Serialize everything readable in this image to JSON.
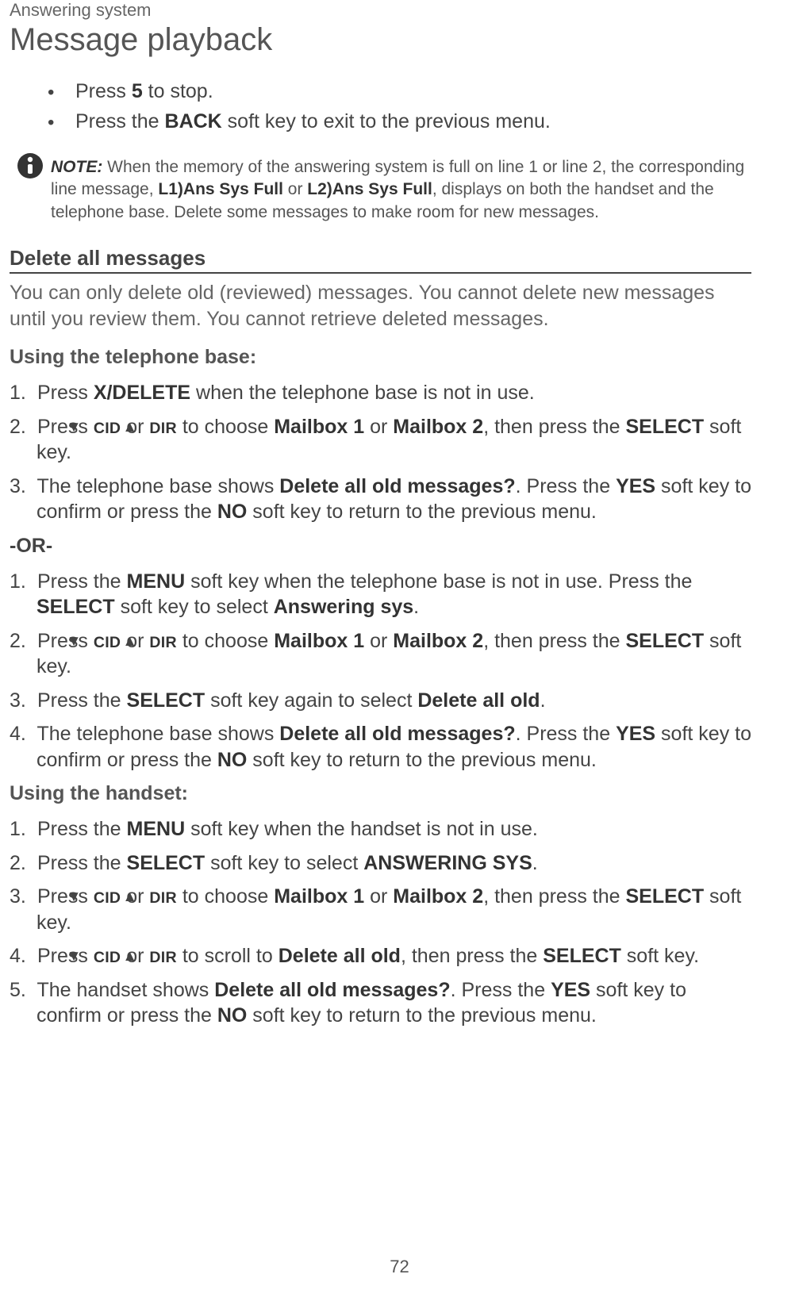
{
  "breadcrumb": "Answering system",
  "title": "Message playback",
  "bullets": {
    "b0_pre": "Press ",
    "b0_bold": "5",
    "b0_post": " to stop.",
    "b1_pre": "Press the ",
    "b1_bold": "BACK",
    "b1_post": " soft key to exit to the previous menu."
  },
  "note": {
    "label": "NOTE:",
    "t1": " When the memory of the answering system is full on line 1 or line 2, the corresponding line message, ",
    "b1": "L1)Ans Sys Full",
    "t2": " or ",
    "b2": "L2)Ans Sys Full",
    "t3": ", displays on both the handset and the telephone base. Delete some messages to make room for new messages."
  },
  "section_heading": "Delete all messages",
  "section_intro": "You can only delete old (reviewed) messages. You cannot delete new messages until you review them. You cannot retrieve deleted messages.",
  "subA_heading": "Using the telephone base:",
  "stepsA": {
    "s1_pre": "Press ",
    "s1_b1": "X/DELETE",
    "s1_post": " when the telephone base is not in use.",
    "s2_pre": "Press ",
    "s2_cid": "CID",
    "s2_or": " or ",
    "s2_dir": "DIR",
    "s2_mid": " to choose ",
    "s2_m1": "Mailbox 1",
    "s2_or2": " or ",
    "s2_m2": "Mailbox 2",
    "s2_then": ", then press the ",
    "s2_sel": "SELECT",
    "s2_end": " soft key.",
    "s3_pre": "The telephone base shows ",
    "s3_q": "Delete all old messages?",
    "s3_mid1": ". Press the ",
    "s3_yes": "YES",
    "s3_mid2": " soft key to confirm or press the ",
    "s3_no": "NO",
    "s3_end": " soft key to return to the previous menu."
  },
  "or_text": "-OR-",
  "stepsB": {
    "s1_pre": "Press the ",
    "s1_menu": "MENU",
    "s1_mid": " soft key when the telephone base is not in use. Press the ",
    "s1_sel": "SELECT",
    "s1_mid2": " soft key to select ",
    "s1_ans": "Answering sys",
    "s1_end": ".",
    "s2_pre": "Press ",
    "s2_cid": "CID",
    "s2_or": " or ",
    "s2_dir": "DIR",
    "s2_mid": " to choose ",
    "s2_m1": "Mailbox 1",
    "s2_or2": " or ",
    "s2_m2": "Mailbox 2",
    "s2_then": ", then press the ",
    "s2_sel": "SELECT",
    "s2_end": " soft key.",
    "s3_pre": "Press the ",
    "s3_sel": "SELECT",
    "s3_mid": " soft key again to select ",
    "s3_del": "Delete all old",
    "s3_end": ".",
    "s4_pre": "The telephone base shows ",
    "s4_q": "Delete all old messages?",
    "s4_mid1": ". Press the ",
    "s4_yes": "YES",
    "s4_mid2": " soft key to confirm or press the ",
    "s4_no": "NO",
    "s4_end": " soft key to return to the previous menu."
  },
  "subC_heading": "Using the handset:",
  "stepsC": {
    "s1_pre": "Press the ",
    "s1_menu": "MENU",
    "s1_end": " soft key when the handset is not in use.",
    "s2_pre": "Press the ",
    "s2_sel": "SELECT",
    "s2_mid": " soft key to select ",
    "s2_ans": "ANSWERING SYS",
    "s2_end": ".",
    "s3_pre": "Press ",
    "s3_cid": "CID",
    "s3_or": " or ",
    "s3_dir": "DIR",
    "s3_mid": " to choose ",
    "s3_m1": "Mailbox 1",
    "s3_or2": " or ",
    "s3_m2": "Mailbox 2",
    "s3_then": ", then press the ",
    "s3_sel": "SELECT",
    "s3_end": " soft key.",
    "s4_pre": "Press ",
    "s4_cid": "CID",
    "s4_or": " or ",
    "s4_dir": "DIR",
    "s4_mid": " to scroll to ",
    "s4_del": "Delete all old",
    "s4_then": ", then press the ",
    "s4_sel": "SELECT",
    "s4_end": " soft key.",
    "s5_pre": "The handset shows ",
    "s5_q": "Delete all old messages?",
    "s5_mid1": ". Press the ",
    "s5_yes": "YES",
    "s5_mid2": " soft key to confirm or press the ",
    "s5_no": "NO",
    "s5_end": " soft key to return to the previous menu."
  },
  "page_number": "72"
}
